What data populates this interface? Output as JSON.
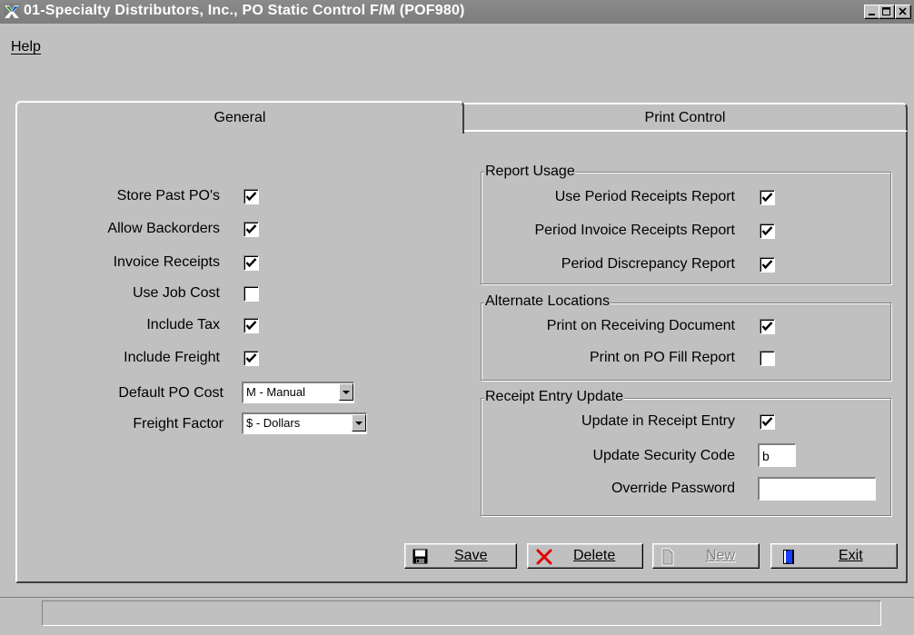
{
  "window": {
    "title": "01-Specialty Distributors, Inc., PO Static Control F/M (POF980)",
    "app_icon": "x-app-icon"
  },
  "menu": {
    "help": "Help"
  },
  "tabs": {
    "general": "General",
    "print_control": "Print Control",
    "active": "General"
  },
  "general": {
    "fields": [
      {
        "label": "Store Past PO's",
        "checked": true
      },
      {
        "label": "Allow Backorders",
        "checked": true
      },
      {
        "label": "Invoice Receipts",
        "checked": true
      },
      {
        "label": "Use Job Cost",
        "checked": false
      },
      {
        "label": "Include Tax",
        "checked": true
      },
      {
        "label": "Include Freight",
        "checked": true
      }
    ],
    "default_po_cost": {
      "label": "Default PO Cost",
      "value": "M - Manual"
    },
    "freight_factor": {
      "label": "Freight Factor",
      "value": "$ - Dollars"
    }
  },
  "report_usage": {
    "title": "Report Usage",
    "items": [
      {
        "label": "Use Period Receipts Report",
        "checked": true
      },
      {
        "label": "Period Invoice Receipts Report",
        "checked": true
      },
      {
        "label": "Period Discrepancy Report",
        "checked": true
      }
    ]
  },
  "alternate_locations": {
    "title": "Alternate Locations",
    "items": [
      {
        "label": "Print on Receiving Document",
        "checked": true
      },
      {
        "label": "Print on PO Fill Report",
        "checked": false
      }
    ]
  },
  "receipt_entry_update": {
    "title": "Receipt Entry Update",
    "update_in_receipt_entry": {
      "label": "Update in Receipt Entry",
      "checked": true
    },
    "update_security_code": {
      "label": "Update Security Code",
      "value": "b"
    },
    "override_password": {
      "label": "Override Password",
      "value": ""
    }
  },
  "buttons": {
    "save": "Save",
    "delete": "Delete",
    "new": "New",
    "exit": "Exit"
  },
  "colors": {
    "face": "#c0c0c0",
    "titlebar": "#808080",
    "disabled_text": "#808080",
    "delete_x": "#e00000"
  }
}
